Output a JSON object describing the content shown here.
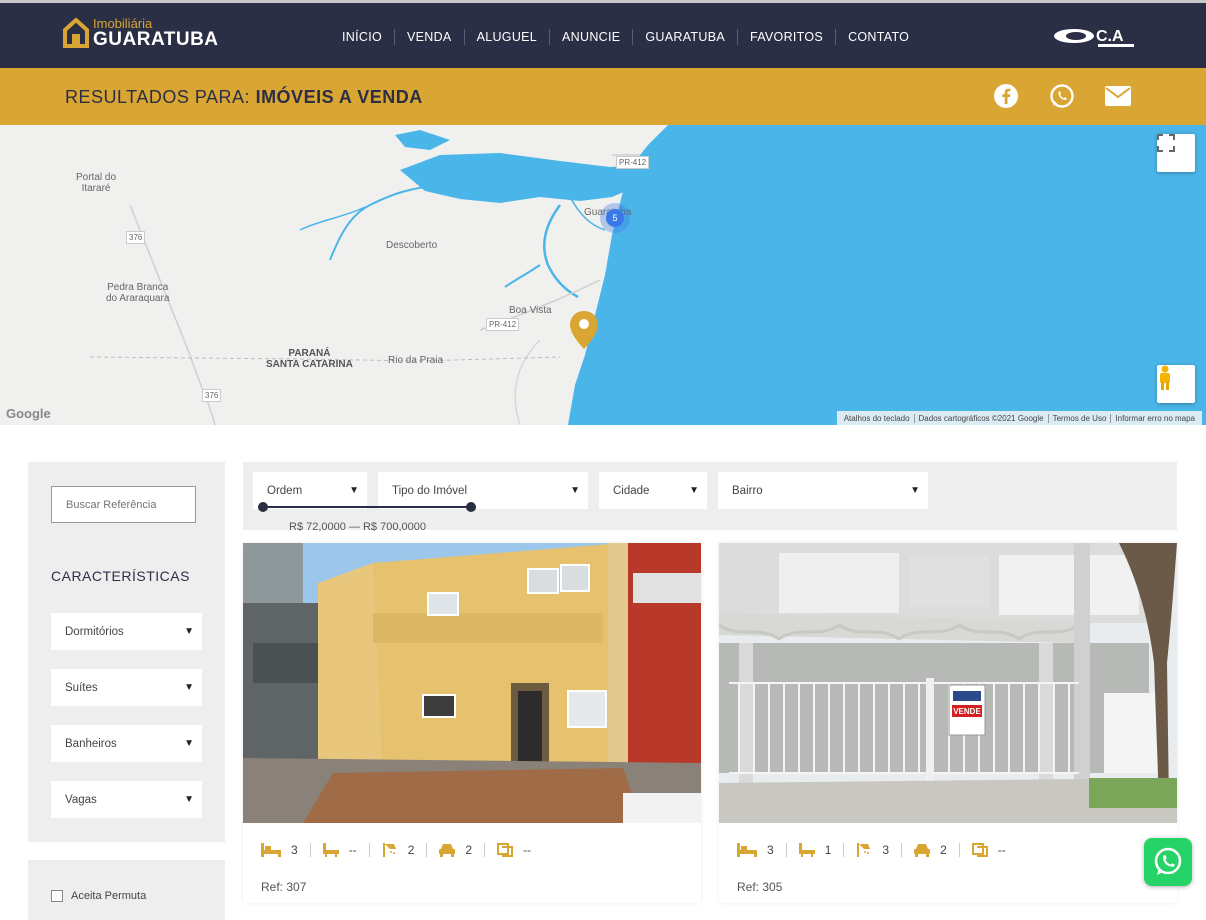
{
  "header": {
    "logo_small": "Imobiliária",
    "logo_big": "GUARATUBA",
    "nav": [
      "INÍCIO",
      "VENDA",
      "ALUGUEL",
      "ANUNCIE",
      "GUARATUBA",
      "FAVORITOS",
      "CONTATO"
    ],
    "partner_logo": "C.A"
  },
  "results": {
    "prefix": "RESULTADOS PARA:",
    "query": "IMÓVEIS A VENDA",
    "social_icons": [
      "facebook-icon",
      "whatsapp-icon",
      "email-icon"
    ],
    "accent_color": "#d9a533",
    "nav_color": "#2b2f45"
  },
  "map": {
    "labels": {
      "portal": "Portal do\nItararé",
      "descoberto": "Descoberto",
      "pedra": "Pedra Branca\ndo Araraquara",
      "parana": "PARANÁ\nSANTA CATARINA",
      "rio_praia": "Rio da Praia",
      "boa_vista": "Boa Vista",
      "guaratuba": "Guaratuba",
      "pr412_top": "PR-412",
      "pr412": "PR-412",
      "road376": "376",
      "road376b": "376"
    },
    "cluster_count": "5",
    "google": "Google",
    "footer": [
      "Atalhos do teclado",
      "Dados cartográficos ©2021 Google",
      "Termos de Uso",
      "Informar erro no mapa"
    ]
  },
  "sidebar": {
    "ref_placeholder": "Buscar Referência",
    "title": "CARACTERÍSTICAS",
    "selects": [
      "Dormitórios",
      "Suítes",
      "Banheiros",
      "Vagas"
    ],
    "permuta": "Aceita Permuta"
  },
  "filters": {
    "order": "Ordem",
    "type": "Tipo do Imóvel",
    "city": "Cidade",
    "district": "Bairro",
    "price_range": "R$ 72,0000 — R$ 700,0000"
  },
  "listings": [
    {
      "bedrooms": "3",
      "suites": "--",
      "bathrooms": "2",
      "parking": "2",
      "area": "--",
      "ref": "Ref: 307"
    },
    {
      "bedrooms": "3",
      "suites": "1",
      "bathrooms": "3",
      "parking": "2",
      "area": "--",
      "ref": "Ref: 305",
      "sign_text": "VENDE"
    }
  ]
}
